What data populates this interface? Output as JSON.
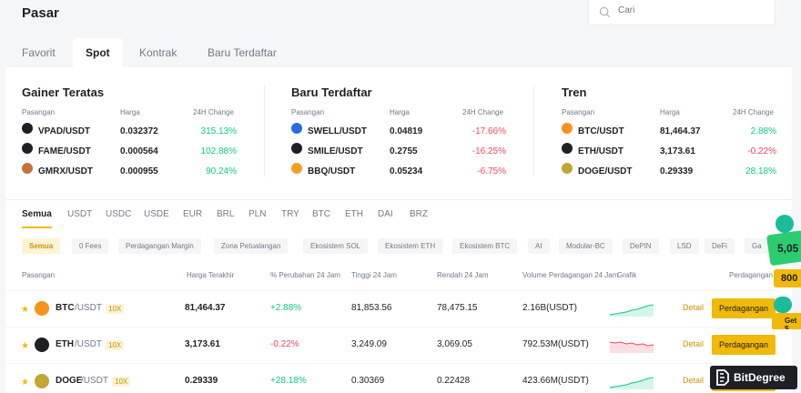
{
  "header": {
    "title": "Pasar",
    "search_placeholder": "Cari"
  },
  "tabs": [
    "Favorit",
    "Spot",
    "Kontrak",
    "Baru Terdaftar"
  ],
  "columns_header": {
    "pair": "Pasangan",
    "price": "Harga",
    "change": "24H Change"
  },
  "gainers": {
    "title": "Gainer Teratas",
    "rows": [
      {
        "pair": "VPAD/USDT",
        "price": "0.032372",
        "change": "315.13%",
        "icon": "vpad-coin-icon",
        "color": "#1e2026"
      },
      {
        "pair": "FAME/USDT",
        "price": "0.000564",
        "change": "102.88%",
        "icon": "fame-coin-icon",
        "color": "#1e2026"
      },
      {
        "pair": "GMRX/USDT",
        "price": "0.000955",
        "change": "90.24%",
        "icon": "gmrx-coin-icon",
        "color": "#c5733a"
      }
    ]
  },
  "new_listed": {
    "title": "Baru Terdaftar",
    "rows": [
      {
        "pair": "SWELL/USDT",
        "price": "0.04819",
        "change": "-17.66%",
        "icon": "swell-coin-icon",
        "color": "#2a6bdb"
      },
      {
        "pair": "SMILE/USDT",
        "price": "0.2755",
        "change": "-16.25%",
        "icon": "smile-coin-icon",
        "color": "#1e2026"
      },
      {
        "pair": "BBQ/USDT",
        "price": "0.05234",
        "change": "-6.75%",
        "icon": "bbq-coin-icon",
        "color": "#f0a020"
      }
    ]
  },
  "trend": {
    "title": "Tren",
    "rows": [
      {
        "pair": "BTC/USDT",
        "price": "81,464.37",
        "change": "2.88%",
        "icon": "btc-coin-icon",
        "color": "#f7931a"
      },
      {
        "pair": "ETH/USDT",
        "price": "3,173.61",
        "change": "-0.22%",
        "icon": "eth-coin-icon",
        "color": "#1e2026"
      },
      {
        "pair": "DOGE/USDT",
        "price": "0.29339",
        "change": "28.18%",
        "icon": "doge-coin-icon",
        "color": "#c2a633"
      }
    ]
  },
  "quote_tabs": [
    "Semua",
    "USDT",
    "USDC",
    "USDE",
    "EUR",
    "BRL",
    "PLN",
    "TRY",
    "BTC",
    "ETH",
    "DAI",
    "BRZ"
  ],
  "chips": [
    "Semua",
    "0 Fees",
    "Perdagangan Margin",
    "Zona Petualangan",
    "Ekosistem SOL",
    "Ekosistem ETH",
    "Ekosistem BTC",
    "AI",
    "Modular-BC",
    "DePIN",
    "LSD",
    "DeFi",
    "Ga"
  ],
  "table_headers": {
    "pair": "Pasangan",
    "last": "Harga Terakhir",
    "change": "% Perubahan 24 Jam",
    "high": "Tinggi 24 Jam",
    "low": "Rendah 24 Jam",
    "volume": "Volume Perdagangan 24 Jam",
    "chart": "Grafik",
    "trade": "Perdagangan"
  },
  "table_rows": [
    {
      "base": "BTC",
      "quote": "/USDT",
      "lev": "10X",
      "last": "81,464.37",
      "change": "+2.88%",
      "high": "81,853.56",
      "low": "78,475.15",
      "volume": "2.16B(USDT)",
      "detail": "Detail",
      "trade": "Perdagangan",
      "icon": "btc-coin-icon",
      "color": "#f7931a",
      "trend": "up"
    },
    {
      "base": "ETH",
      "quote": "/USDT",
      "lev": "10X",
      "last": "3,173.61",
      "change": "-0.22%",
      "high": "3,249.09",
      "low": "3,069.05",
      "volume": "792.53M(USDT)",
      "detail": "Detail",
      "trade": "Perdagangan",
      "icon": "eth-coin-icon",
      "color": "#1e2026",
      "trend": "down"
    },
    {
      "base": "DOGE",
      "quote": "/USDT",
      "lev": "10X",
      "last": "0.29339",
      "change": "+28.18%",
      "high": "0.30369",
      "low": "0.22428",
      "volume": "423.66M(USDT)",
      "detail": "Detail",
      "trade": "Perdagangan",
      "icon": "doge-coin-icon",
      "color": "#c2a633",
      "trend": "up"
    }
  ],
  "promo": {
    "value1": "5,05",
    "value2": "800",
    "cta": "Get $"
  },
  "watermark": "BitDegree",
  "colors": {
    "accent": "#f0b90b",
    "up": "#0ecb81",
    "down": "#f6465d"
  }
}
